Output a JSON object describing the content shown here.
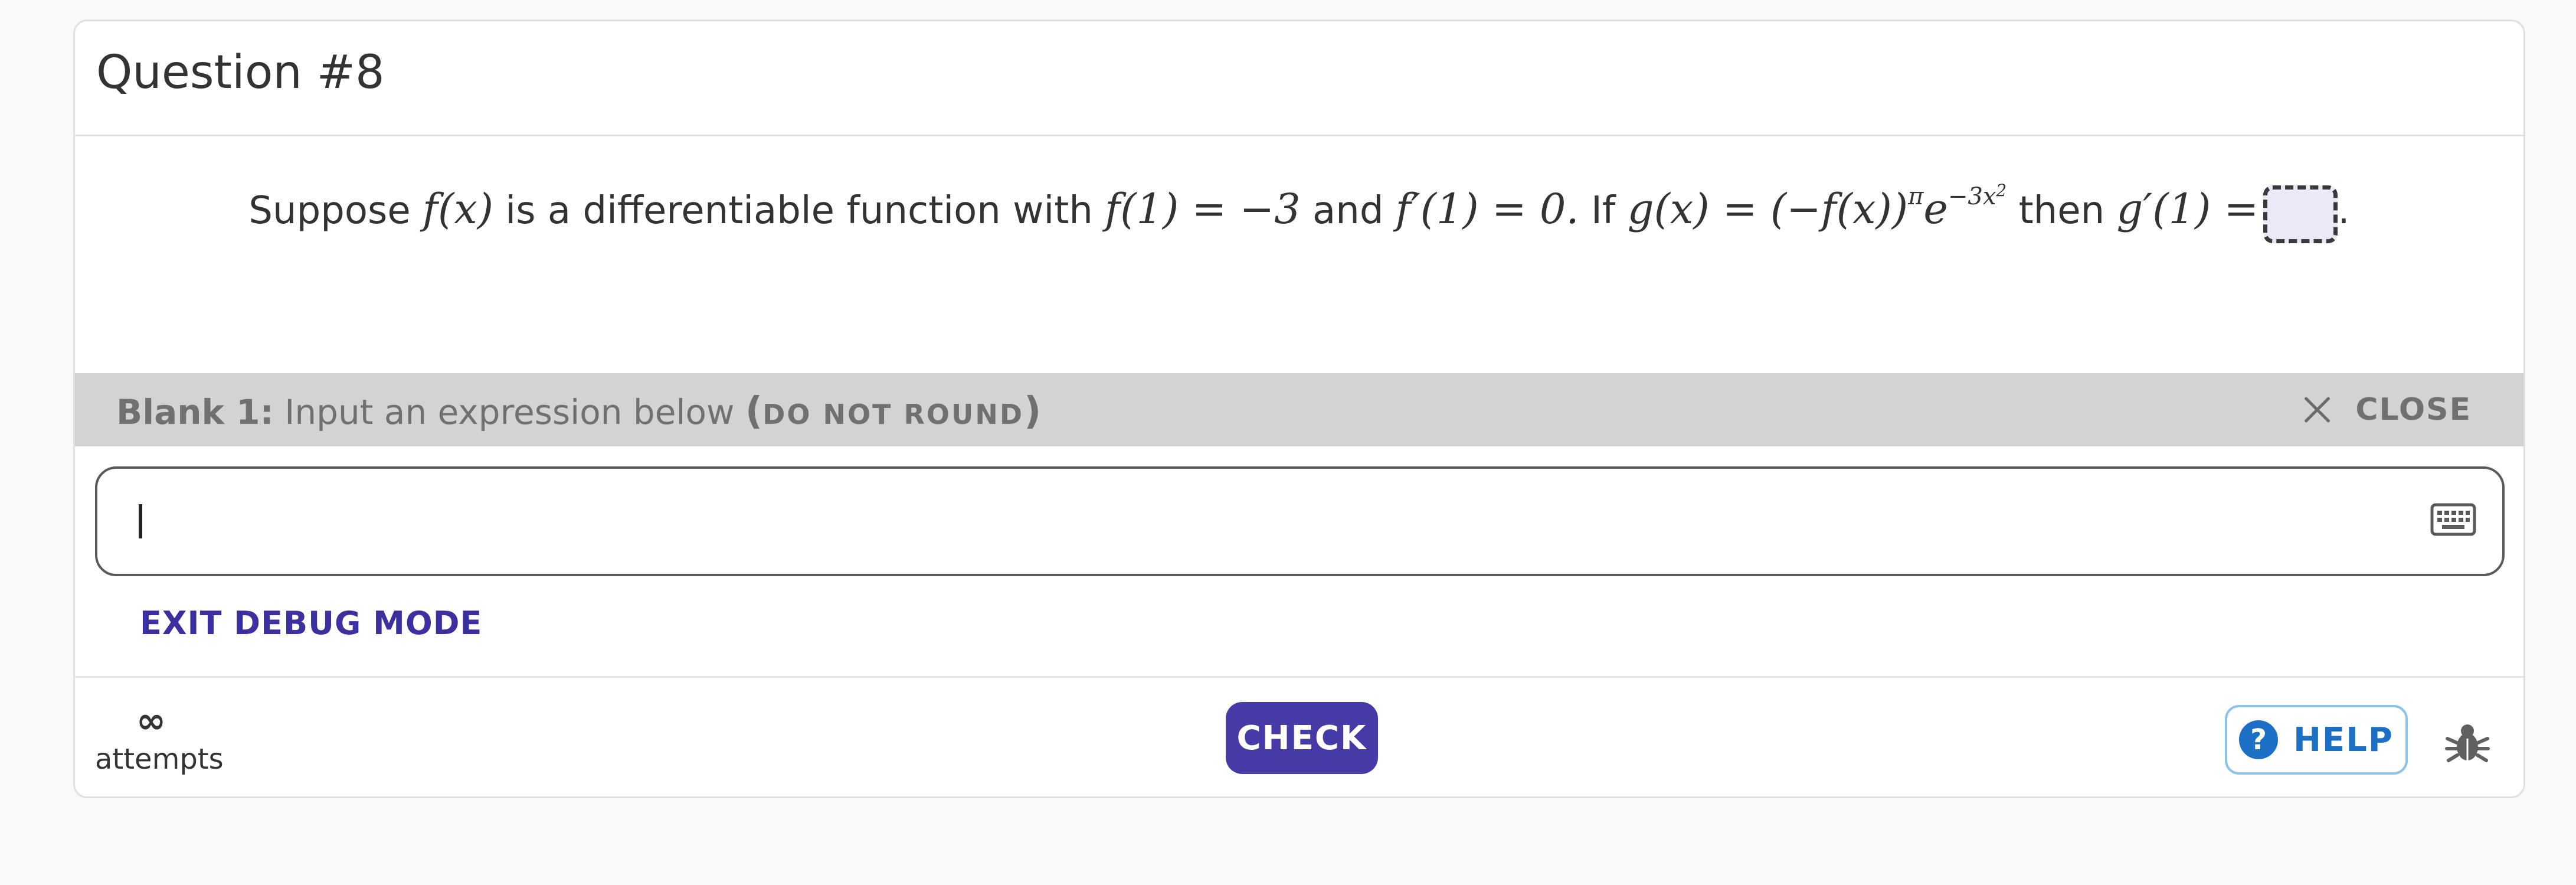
{
  "question": {
    "title": "Question #8",
    "text": {
      "prefix": "Suppose",
      "fx": "f(x)",
      "part2": "is a differentiable function with",
      "f1": "f(1) = −3",
      "and": "and",
      "fp1": "f′(1) = 0.",
      "if": "If",
      "gx": "g(x) = (−f(x))",
      "pi": "π",
      "e": "e",
      "exp": "−3x",
      "exp2": "2",
      "then": "then",
      "gp1": "g′(1) =",
      "period": "."
    }
  },
  "blank_bar": {
    "label": "Blank 1:",
    "instruction": "Input an expression below",
    "paren_open": "(",
    "note": "DO NOT ROUND",
    "paren_close": ")",
    "close_label": "CLOSE"
  },
  "answer_input": {
    "value": ""
  },
  "debug": {
    "label": "EXIT DEBUG MODE"
  },
  "footer": {
    "attempts_symbol": "∞",
    "attempts_label": "attempts",
    "check_label": "CHECK",
    "help_icon": "?",
    "help_label": "HELP"
  },
  "colors": {
    "primary": "#463aa6",
    "help_blue": "#1b6fc4",
    "blank_bar_bg": "#d3d3d3"
  },
  "icons": [
    "close-icon",
    "keyboard-icon",
    "help-icon",
    "bug-icon"
  ]
}
